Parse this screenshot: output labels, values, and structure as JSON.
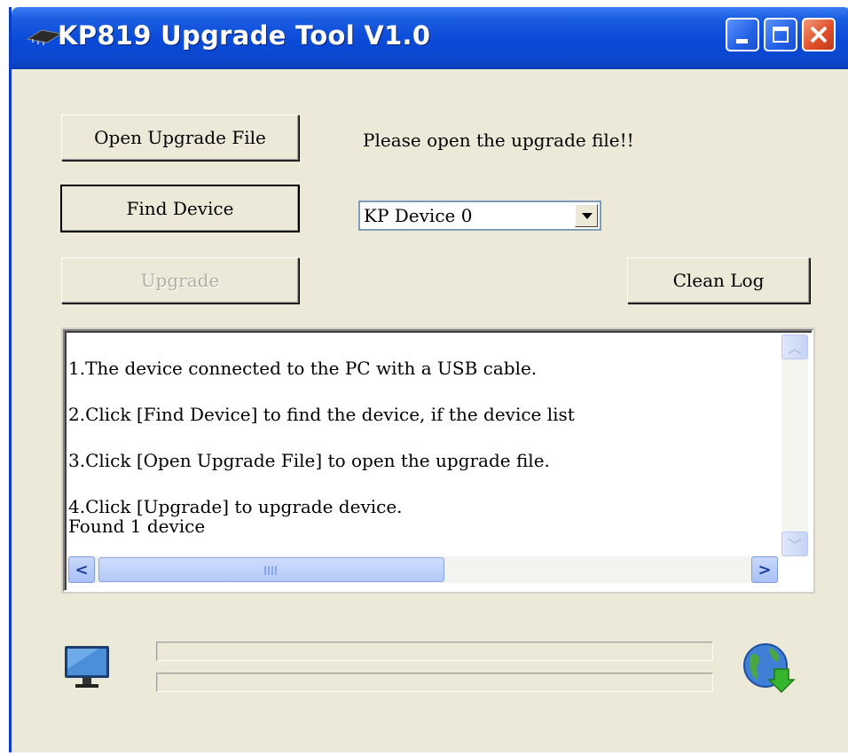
{
  "window": {
    "title": "KP819 Upgrade Tool V1.0"
  },
  "buttons": {
    "open_file": "Open Upgrade File",
    "find_device": "Find Device",
    "upgrade": "Upgrade",
    "clean_log": "Clean Log"
  },
  "status_message": "Please open the upgrade file!!",
  "device_select": {
    "selected": "KP Device 0"
  },
  "log": {
    "lines": [
      "1.The device connected to the PC with a USB cable.",
      "2.Click [Find Device] to find the device, if the device list",
      "3.Click [Open Upgrade File] to open the upgrade file.",
      "4.Click [Upgrade] to upgrade device.",
      "Found 1 device"
    ]
  },
  "progress": {
    "bar1_percent": 0,
    "bar2_percent": 0
  },
  "icons": {
    "app": "chip-icon",
    "computer": "monitor-icon",
    "download": "globe-download-icon"
  },
  "colors": {
    "titlebar": "#0a4ad8",
    "window_bg": "#ece9d8",
    "close_button": "#e0502a",
    "accent": "#1a5ce0"
  }
}
